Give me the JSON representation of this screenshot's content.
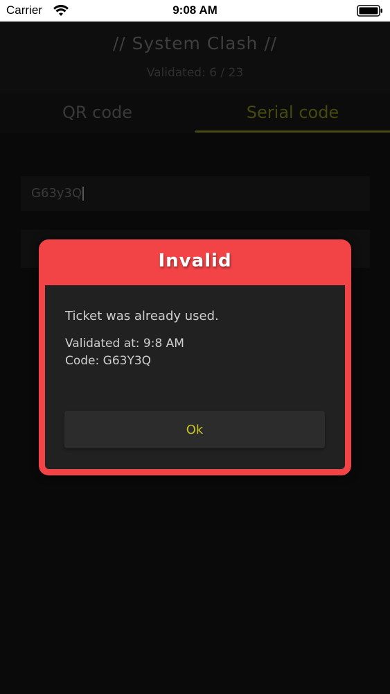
{
  "status_bar": {
    "carrier": "Carrier",
    "time": "9:08 AM"
  },
  "header": {
    "title": "// System Clash //",
    "validated": "Validated: 6 / 23"
  },
  "tabs": [
    {
      "label": "QR code",
      "active": false
    },
    {
      "label": "Serial code",
      "active": true
    }
  ],
  "serial_input": {
    "value": "G63y3Q"
  },
  "modal": {
    "title": "Invalid",
    "message": "Ticket was already used.",
    "validated_at": "Validated at: 9:8 AM",
    "code": "Code: G63Y3Q",
    "ok_label": "Ok"
  },
  "colors": {
    "background": "#0d0d0d",
    "header": "#131313",
    "accent": "#5d6418",
    "modal_red": "#f24446",
    "modal_body": "#212121",
    "ok_text": "#c7c324"
  }
}
